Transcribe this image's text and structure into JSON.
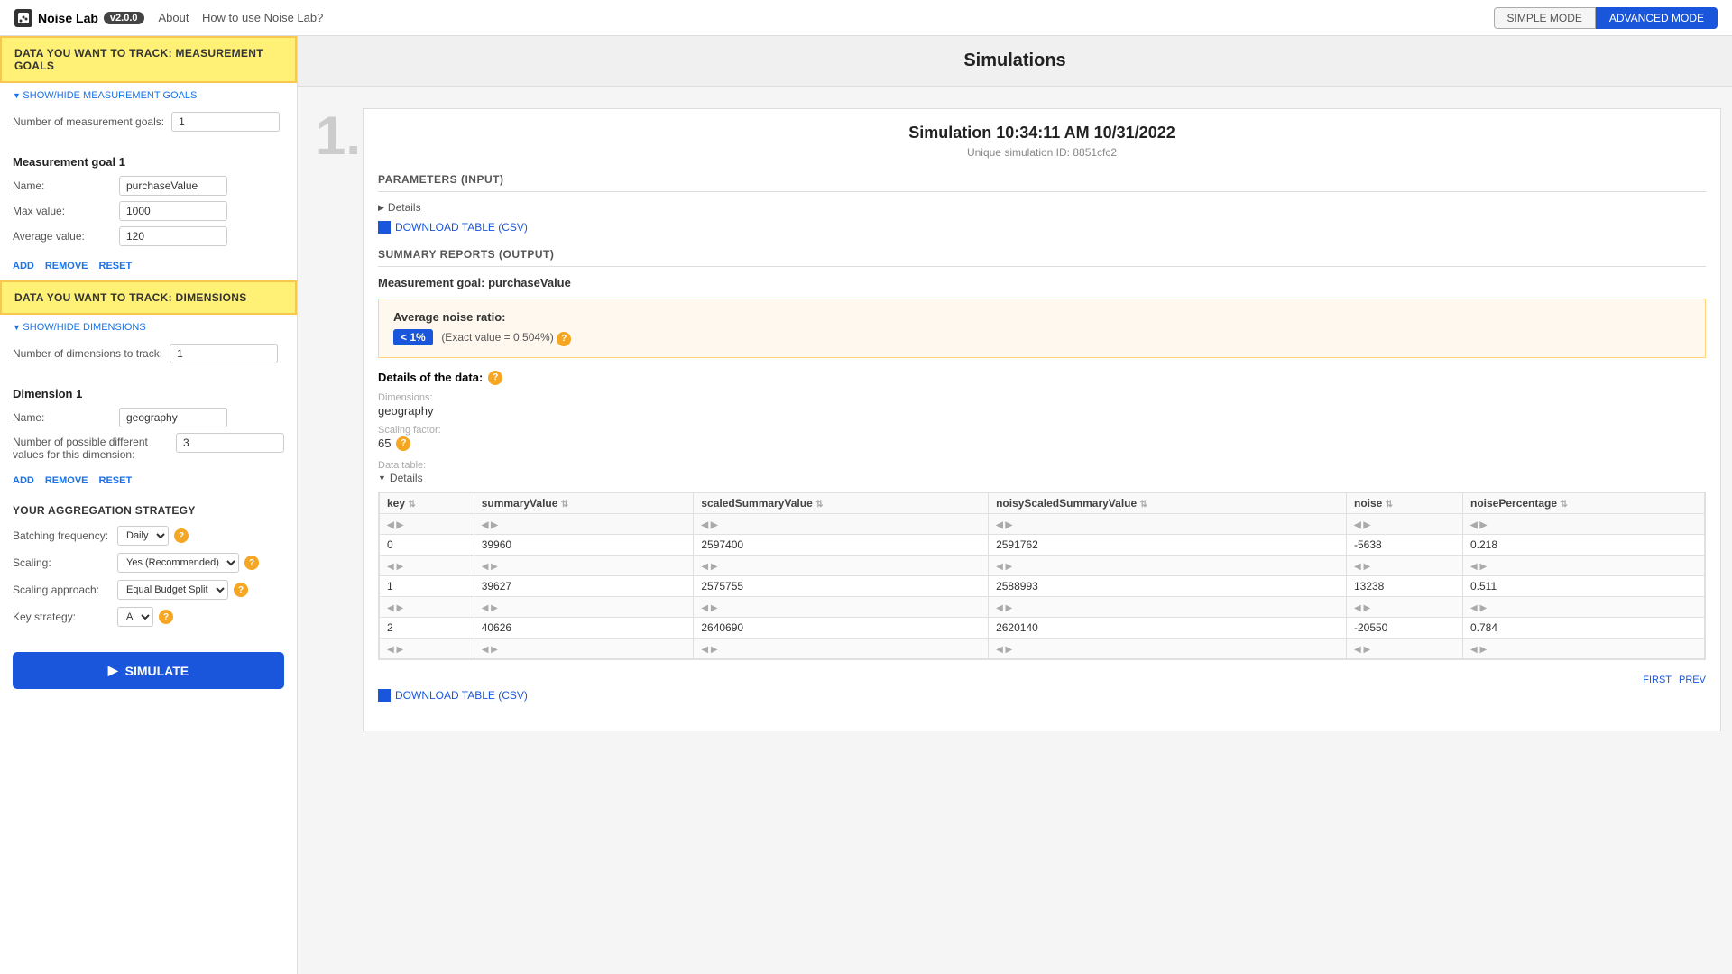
{
  "header": {
    "logo_text": "Noise Lab",
    "version": "v2.0.0",
    "nav_about": "About",
    "nav_how": "How to use Noise Lab?",
    "mode_simple": "SIMPLE MODE",
    "mode_advanced": "ADVANCED MODE"
  },
  "sidebar": {
    "section1_title": "DATA YOU WANT TO TRACK: MEASUREMENT GOALS",
    "toggle_goals": "SHOW/HIDE MEASUREMENT GOALS",
    "num_goals_label": "Number of measurement goals:",
    "num_goals_value": "1",
    "goal1_title": "Measurement goal 1",
    "name_label": "Name:",
    "name_value": "purchaseValue",
    "max_label": "Max value:",
    "max_value": "1000",
    "avg_label": "Average value:",
    "avg_value": "120",
    "add_label": "ADD",
    "remove_label": "REMOVE",
    "reset_label": "RESET",
    "section2_title": "DATA YOU WANT TO TRACK: DIMENSIONS",
    "toggle_dims": "SHOW/HIDE DIMENSIONS",
    "num_dims_label": "Number of dimensions to track:",
    "num_dims_value": "1",
    "dim1_title": "Dimension 1",
    "dim_name_label": "Name:",
    "dim_name_value": "geography",
    "dim_possible_label": "Number of possible different values for this dimension:",
    "dim_possible_value": "3",
    "dim_add": "ADD",
    "dim_remove": "REMOVE",
    "dim_reset": "RESET",
    "agg_title": "YOUR AGGREGATION STRATEGY",
    "batching_label": "Batching frequency:",
    "batching_value": "Daily",
    "scaling_label": "Scaling:",
    "scaling_value": "Yes (Recommended)",
    "scaling_approach_label": "Scaling approach:",
    "scaling_approach_value": "Equal Budget Split",
    "key_strategy_label": "Key strategy:",
    "key_strategy_value": "A",
    "simulate_label": "SIMULATE"
  },
  "main": {
    "simulations_title": "Simulations",
    "sim_title": "Simulation 10:34:11 AM 10/31/2022",
    "sim_id": "Unique simulation ID: 8851cfc2",
    "params_title": "PARAMETERS (INPUT)",
    "details_label": "Details",
    "download_label": "DOWNLOAD TABLE (CSV)",
    "summary_title": "SUMMARY REPORTS (OUTPUT)",
    "goal_label": "Measurement goal: purchaseValue",
    "avg_noise_label": "Average noise ratio:",
    "noise_badge": "< 1%",
    "noise_exact": "(Exact value = 0.504%)",
    "details_of_data_label": "Details of the data:",
    "dimensions_label": "Dimensions:",
    "dimensions_value": "geography",
    "scaling_factor_label": "Scaling factor:",
    "scaling_factor_value": "65",
    "data_table_label": "Data table:",
    "table_toggle": "Details",
    "table_headers": [
      "key",
      "summaryValue",
      "scaledSummaryValue",
      "noisyScaledSummaryValue",
      "noise",
      "noisePercentage"
    ],
    "table_rows": [
      [
        "0",
        "39960",
        "2597400",
        "2591762",
        "-5638",
        "0.218"
      ],
      [
        "1",
        "39627",
        "2575755",
        "2588993",
        "13238",
        "0.511"
      ],
      [
        "2",
        "40626",
        "2640690",
        "2620140",
        "-20550",
        "0.784"
      ]
    ],
    "pagination_first": "FIRST",
    "pagination_prev": "PREV",
    "download2_label": "DOWNLOAD TABLE (CSV)"
  }
}
